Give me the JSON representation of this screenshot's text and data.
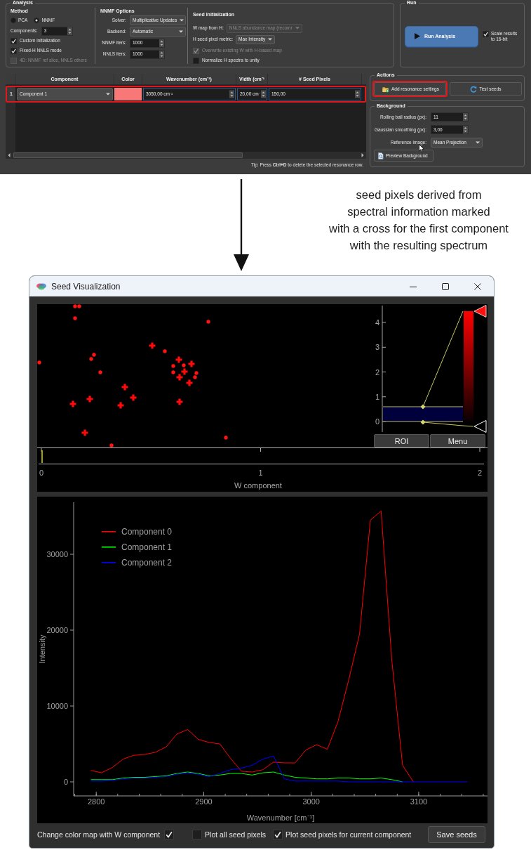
{
  "analysis": {
    "title": "Analysis",
    "method": {
      "title": "Method",
      "options": [
        {
          "label": "PCA",
          "selected": false
        },
        {
          "label": "NNMF",
          "selected": true
        }
      ],
      "components": {
        "label": "Components:",
        "value": "3"
      },
      "checkboxes": [
        {
          "label": "Custom initialization",
          "checked": true,
          "disabled": false
        },
        {
          "label": "Fixed-H NNLS mode",
          "checked": true,
          "disabled": false
        },
        {
          "label": "4D: NNMF ref slice, NNLS others",
          "checked": false,
          "disabled": true
        }
      ]
    },
    "nnmf_options": {
      "title": "NNMF Options",
      "fields": [
        {
          "kind": "combo",
          "label": "Solver:",
          "value": "Multiplicative Updates"
        },
        {
          "kind": "combo",
          "label": "Backend:",
          "value": "Automatic"
        },
        {
          "kind": "spin",
          "label": "NNMF iters:",
          "value": "1000"
        },
        {
          "kind": "spin",
          "label": "NNLS iters:",
          "value": "1000"
        }
      ]
    },
    "seed_initialization": {
      "title": "Seed Initialization",
      "fields": [
        {
          "label": "W map from H:",
          "value": "NNLS abundance map (recomr",
          "disabled": true
        },
        {
          "label": "H seed pixel metric:",
          "value": "Max Intensity",
          "disabled": false
        }
      ],
      "checkboxes": [
        {
          "label": "Overwrite existing W with H-based map",
          "checked": true,
          "disabled": true
        },
        {
          "label": "Normalize H spectra to unity",
          "checked": false,
          "disabled": false
        }
      ]
    }
  },
  "run": {
    "title": "Run",
    "button": "Run Analysis",
    "checkbox": {
      "label": "Scale results to 16-bit",
      "checked": true
    }
  },
  "resonance_table": {
    "columns": [
      "Component",
      "Color",
      "Wavenumber (cm⁻¹)",
      "Vidth (cm⁻¹",
      "# Seed Pixels"
    ],
    "rows": [
      {
        "number": "1",
        "component": "Component 1",
        "color": "#f87878",
        "wavenumber": "3050,00 cm⁻¹",
        "width": "20,00 cm⁻",
        "seed_pixels": "150,00",
        "highlighted": true
      }
    ],
    "tip": "Tip: Press **Ctrl+D** to delete the selected resonance row."
  },
  "actions": {
    "title": "Actions",
    "buttons": [
      {
        "label": "Add resonance settings",
        "highlighted": true
      },
      {
        "label": "Test seeds",
        "highlighted": false
      }
    ]
  },
  "background": {
    "title": "Background",
    "fields": [
      {
        "kind": "spin",
        "label": "Rolling ball radius (px):",
        "value": "11"
      },
      {
        "kind": "spin",
        "label": "Gaussian smoothing (px):",
        "value": "3,00"
      },
      {
        "kind": "combo",
        "label": "Reference image:",
        "value": "Mean Projection"
      }
    ],
    "button": "Preview Background"
  },
  "annotation": {
    "caption_lines": [
      "seed pixels derived from",
      "spectral information marked",
      "with a cross for the first component",
      "with the resulting spectrum"
    ]
  },
  "seed_visualization_window": {
    "title": "Seed Visualization",
    "histogram": {
      "ticks": [
        "4",
        "3",
        "2",
        "1",
        "0"
      ],
      "buttons": [
        "ROI",
        "Menu"
      ]
    },
    "timeline": {
      "ticks": [
        "0",
        "1",
        "2"
      ],
      "label": "W component"
    },
    "spectrum_plot": {
      "chart_data": {
        "type": "line",
        "xlabel": "Wavenumber [cm⁻¹]",
        "ylabel": "Intensity",
        "x": [
          2795,
          2805,
          2815,
          2825,
          2835,
          2845,
          2855,
          2865,
          2875,
          2885,
          2895,
          2905,
          2915,
          2925,
          2935,
          2945,
          2955,
          2965,
          2975,
          2985,
          2995,
          3005,
          3015,
          3025,
          3035,
          3045,
          3055,
          3065,
          3075,
          3085,
          3095,
          3105,
          3115,
          3125,
          3135,
          3145
        ],
        "series": [
          {
            "name": "Component 0",
            "color": "#ff0000",
            "values": [
              1500,
              1200,
              1900,
              3000,
              3500,
              3600,
              3900,
              4600,
              6300,
              6900,
              5600,
              5200,
              5000,
              3100,
              1400,
              1300,
              1600,
              2600,
              2500,
              2500,
              4200,
              4900,
              4300,
              8000,
              13500,
              19500,
              34500,
              35700,
              16000,
              2200,
              0,
              null,
              null,
              null,
              null,
              null
            ]
          },
          {
            "name": "Component 1",
            "color": "#00ff00",
            "values": [
              300,
              300,
              300,
              500,
              600,
              600,
              700,
              800,
              1100,
              1300,
              1100,
              800,
              900,
              1100,
              1100,
              900,
              1200,
              1300,
              900,
              600,
              500,
              400,
              400,
              500,
              500,
              400,
              400,
              500,
              300,
              0,
              null,
              null,
              null,
              null,
              null,
              null
            ]
          },
          {
            "name": "Component 2",
            "color": "#0000ff",
            "values": [
              100,
              100,
              200,
              400,
              500,
              500,
              600,
              700,
              1000,
              1200,
              1000,
              700,
              1100,
              1600,
              1800,
              2200,
              3000,
              3400,
              400,
              100,
              100,
              100,
              100,
              100,
              0,
              0,
              0,
              0,
              0,
              0,
              0,
              0,
              0,
              0,
              0,
              0
            ]
          }
        ],
        "legend": true,
        "xlim": [
          2779,
          3164
        ],
        "ylim": [
          -1850,
          36850
        ],
        "xticks": [
          2800,
          2900,
          3000,
          3100
        ],
        "yticks": [
          {
            "value": 0,
            "label": "0"
          },
          {
            "value": 10000,
            "label": "10000"
          },
          {
            "value": 20000,
            "label": "20000"
          },
          {
            "value": 30000,
            "label": "30000"
          }
        ]
      }
    },
    "options": [
      {
        "kind": "trailing",
        "label": "Change color map with W component",
        "checked": true
      },
      {
        "kind": "leading",
        "label": "Plot all seed pixels",
        "checked": false
      },
      {
        "kind": "leading",
        "label": "Plot seed pixels for current component",
        "checked": true
      }
    ],
    "save_button": "Save seeds"
  }
}
